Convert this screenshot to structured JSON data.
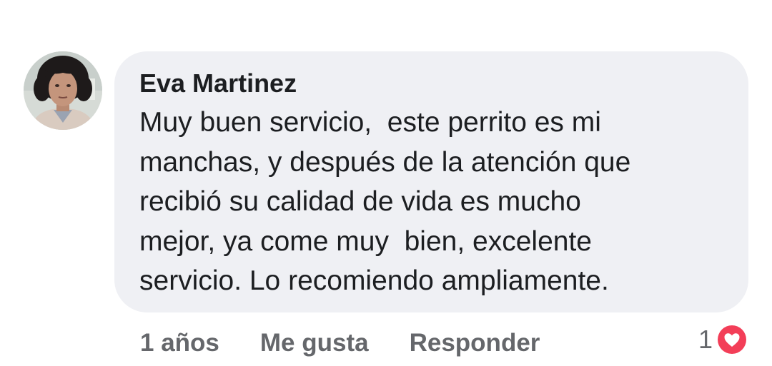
{
  "comment": {
    "author": "Eva Martinez",
    "text_lines": [
      "Muy buen servicio,  este perrito es mi",
      "manchas, y después de la atención que",
      "recibió su calidad de vida es mucho",
      "mejor, ya come muy  bien, excelente",
      "servicio. Lo recomiendo ampliamente."
    ]
  },
  "actions": {
    "time": "1 años",
    "like_label": "Me gusta",
    "reply_label": "Responder"
  },
  "reactions": {
    "count": "1",
    "icon": "love-reaction-icon",
    "color": "#f33e58"
  },
  "colors": {
    "bubble": "#eff0f4",
    "text": "#1c1e21",
    "secondary_text": "#65676b"
  }
}
